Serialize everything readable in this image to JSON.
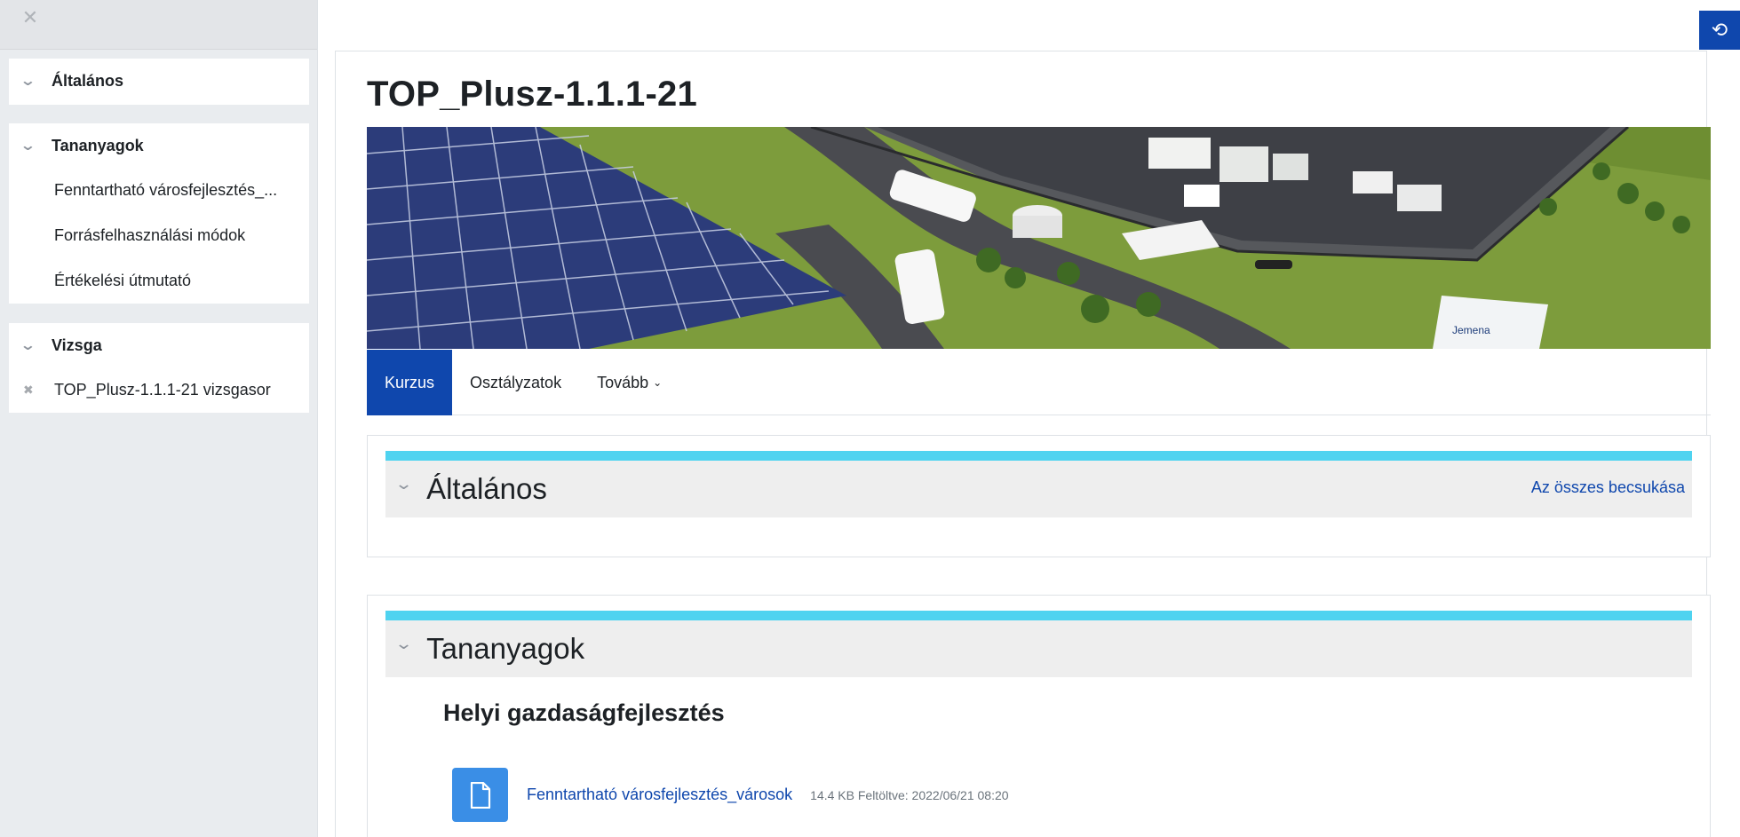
{
  "sidebar": {
    "close_icon": "close-icon",
    "sections": [
      {
        "title": "Általános",
        "items": []
      },
      {
        "title": "Tananyagok",
        "items": [
          "Fenntartható városfejlesztés_...",
          "Forrásfelhasználási módok",
          "Értékelési útmutató"
        ]
      },
      {
        "title": "Vizsga",
        "items": [
          "TOP_Plusz-1.1.1-21 vizsgasor"
        ]
      }
    ]
  },
  "top_right_button": {
    "icon": "history-icon"
  },
  "page": {
    "title": "TOP_Plusz-1.1.1-21"
  },
  "tabs": {
    "items": [
      {
        "label": "Kurzus",
        "active": true
      },
      {
        "label": "Osztályzatok",
        "active": false
      },
      {
        "label": "Tovább",
        "active": false
      }
    ]
  },
  "sections": [
    {
      "title": "Általános",
      "collapse_all": "Az összes becsukása"
    },
    {
      "title": "Tananyagok",
      "subheading": "Helyi gazdaságfejlesztés",
      "activity": {
        "name": "Fenntartható városfejlesztés_városok",
        "meta": "14.4 KB Feltöltve: 2022/06/21 08:20",
        "icon": "file-icon"
      }
    }
  ],
  "colors": {
    "accent": "#0f47ad",
    "section_bar": "#4fd3f0",
    "file_icon_bg": "#3a8ee6"
  }
}
